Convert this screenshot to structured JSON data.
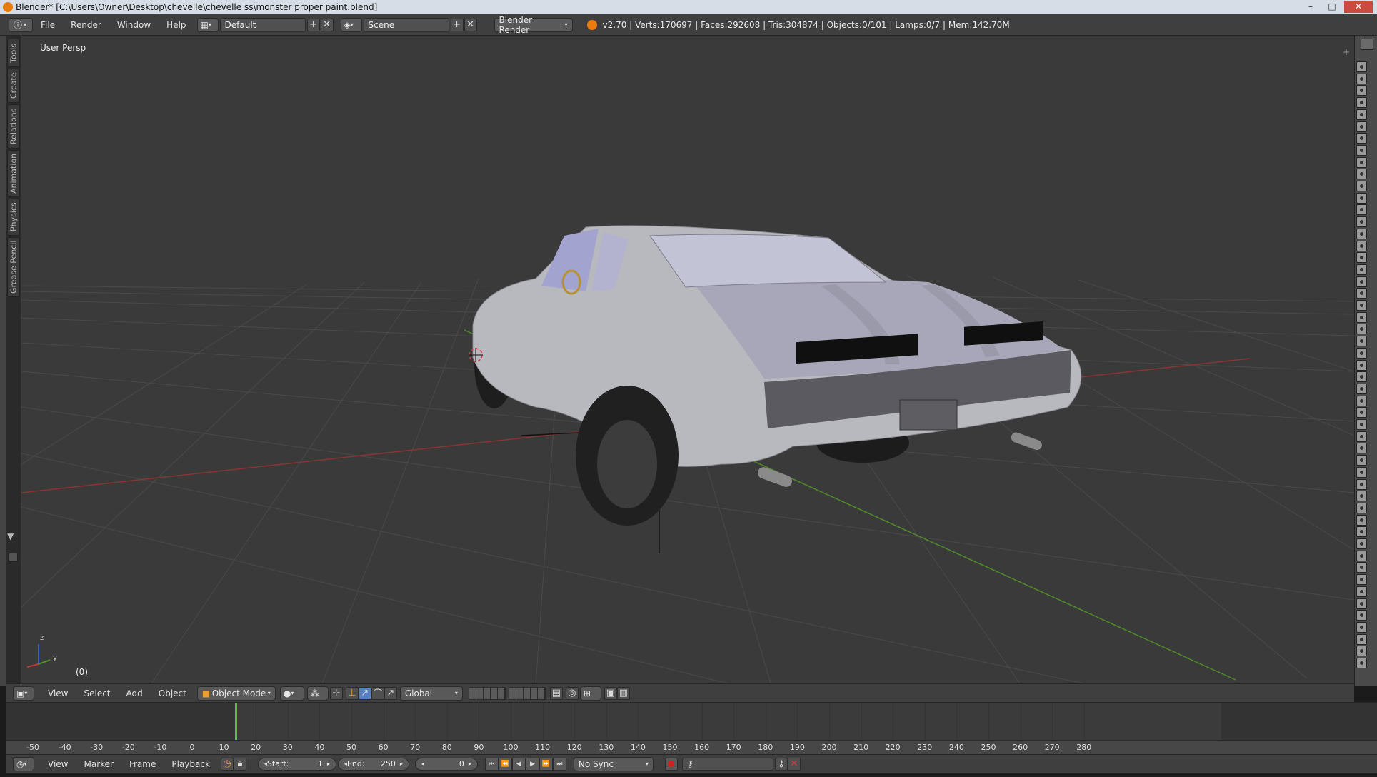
{
  "titlebar": {
    "title": "Blender* [C:\\Users\\Owner\\Desktop\\chevelle\\chevelle ss\\monster proper paint.blend]",
    "minimize": "–",
    "maximize": "□",
    "close": "✕"
  },
  "infobar": {
    "menus": [
      "File",
      "Render",
      "Window",
      "Help"
    ],
    "layout_name": "Default",
    "scene_name": "Scene",
    "render_engine": "Blender Render",
    "stats": "v2.70 | Verts:170697 | Faces:292608 | Tris:304874 | Objects:0/101 | Lamps:0/7 | Mem:142.70M"
  },
  "left_tabs": [
    "Tools",
    "Create",
    "Relations",
    "Animation",
    "Physics",
    "Grease Pencil"
  ],
  "viewport": {
    "view_label": "User Persp",
    "frame_label": "(0)",
    "axis_z": "z",
    "axis_y": "y"
  },
  "view_header": {
    "menus": [
      "View",
      "Select",
      "Add",
      "Object"
    ],
    "mode": "Object Mode",
    "orientation": "Global"
  },
  "timeline": {
    "ticks": [
      "-50",
      "-40",
      "-30",
      "-20",
      "-10",
      "0",
      "10",
      "20",
      "30",
      "40",
      "50",
      "60",
      "70",
      "80",
      "90",
      "100",
      "110",
      "120",
      "130",
      "140",
      "150",
      "160",
      "170",
      "180",
      "190",
      "200",
      "210",
      "220",
      "230",
      "240",
      "250",
      "260",
      "270",
      "280"
    ]
  },
  "time_header": {
    "menus": [
      "View",
      "Marker",
      "Frame",
      "Playback"
    ],
    "start_label": "Start:",
    "start_value": "1",
    "end_label": "End:",
    "end_value": "250",
    "current_frame": "0",
    "sync": "No Sync"
  },
  "colors": {
    "accent_orange": "#e87d0d",
    "x_axis": "#a83a3a",
    "y_axis": "#5e9c2e",
    "current_frame": "#5fbf3f"
  }
}
